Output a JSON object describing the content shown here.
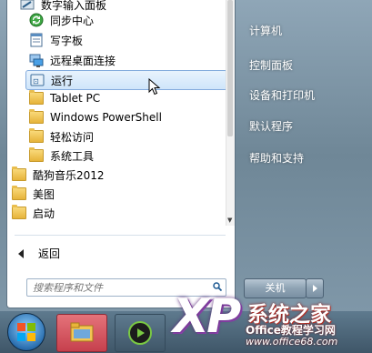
{
  "start_menu": {
    "programs": [
      {
        "label": "数字输入面板",
        "icon": "pen-tablet-icon"
      },
      {
        "label": "同步中心",
        "icon": "sync-center-icon"
      },
      {
        "label": "写字板",
        "icon": "wordpad-icon"
      },
      {
        "label": "远程桌面连接",
        "icon": "remote-desktop-icon"
      },
      {
        "label": "运行",
        "icon": "run-icon",
        "selected": true
      },
      {
        "label": "Tablet PC",
        "icon": "folder-icon"
      },
      {
        "label": "Windows PowerShell",
        "icon": "folder-icon"
      },
      {
        "label": "轻松访问",
        "icon": "folder-icon"
      },
      {
        "label": "系统工具",
        "icon": "folder-icon"
      },
      {
        "label": "酷狗音乐2012",
        "icon": "folder-icon"
      },
      {
        "label": "美图",
        "icon": "folder-icon"
      },
      {
        "label": "启动",
        "icon": "folder-icon"
      }
    ],
    "back_label": "返回",
    "search_placeholder": "搜索程序和文件",
    "right_links": [
      "计算机",
      "控制面板",
      "设备和打印机",
      "默认程序",
      "帮助和支持"
    ],
    "shutdown_label": "关机"
  },
  "watermark": {
    "logo": "XP",
    "brand": "系统之家",
    "site_label": "Office教程学习网",
    "url": "www.office68.com"
  },
  "colors": {
    "selection": "#cfe5fa",
    "taskbar_button": "#c6404d"
  }
}
